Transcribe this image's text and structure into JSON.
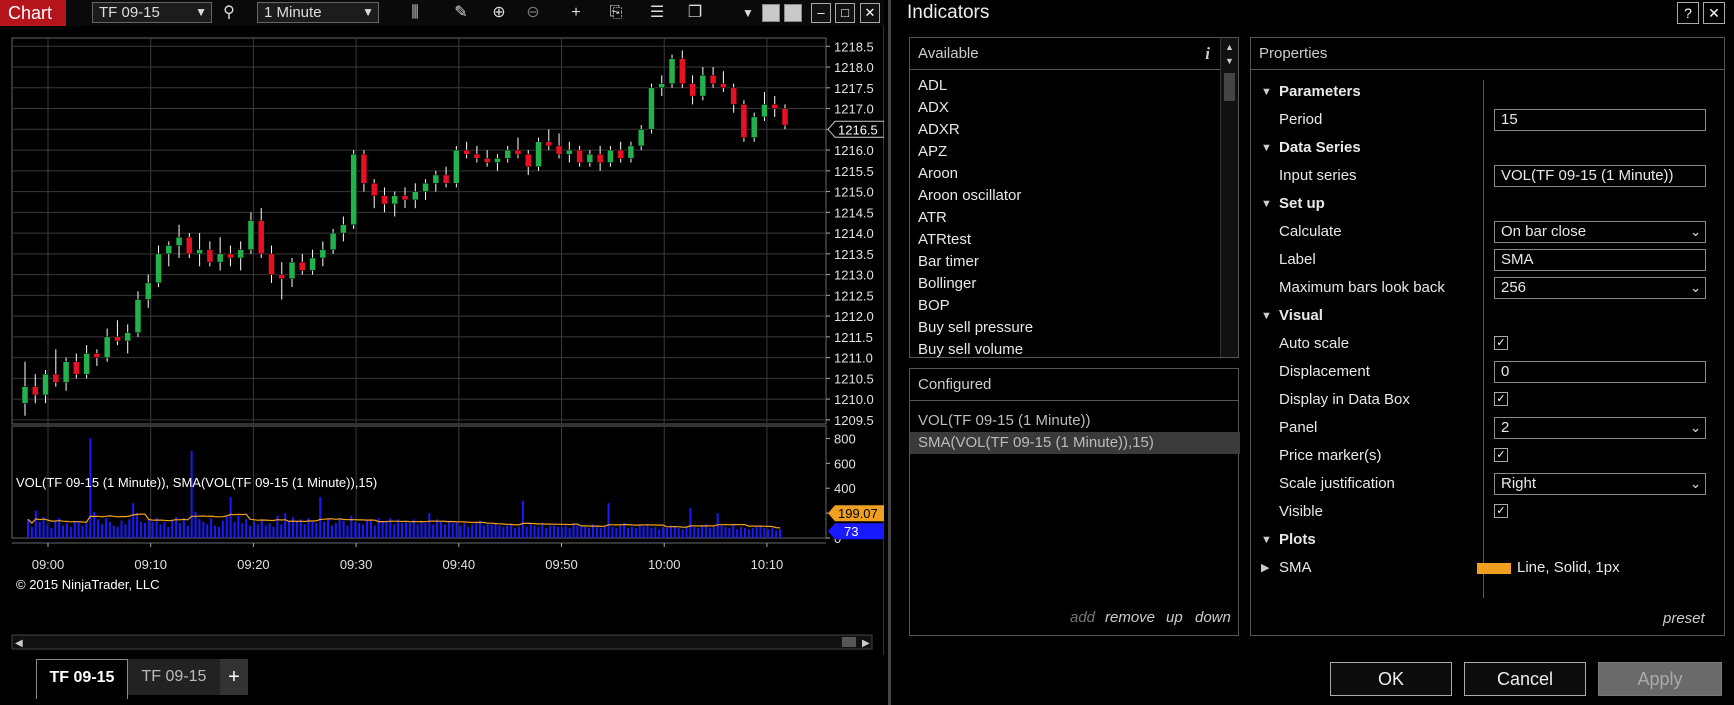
{
  "chart_window": {
    "title": "Chart",
    "instrument": "TF 09-15",
    "interval": "1 Minute",
    "tabs": [
      "TF 09-15",
      "TF 09-15"
    ],
    "add_tab_label": "+",
    "copyright": "© 2015 NinjaTrader, LLC",
    "indicator_label": "VOL(TF 09-15 (1 Minute)), SMA(VOL(TF 09-15 (1 Minute)),15)",
    "win_buttons": {
      "minimize": "–",
      "maximize": "□",
      "close": "✕"
    }
  },
  "chart_data": [
    {
      "type": "candlestick",
      "price_ticks": [
        "1218.5",
        "1218.0",
        "1217.5",
        "1217.0",
        "1216.5",
        "1216.0",
        "1215.5",
        "1215.0",
        "1214.5",
        "1214.0",
        "1213.5",
        "1213.0",
        "1212.5",
        "1212.0",
        "1211.5",
        "1211.0",
        "1210.5",
        "1210.0",
        "1209.5"
      ],
      "ylim": [
        1209.4,
        1218.7
      ],
      "last_price_label": "1216.5",
      "time_ticks": [
        "09:00",
        "09:10",
        "09:20",
        "09:30",
        "09:40",
        "09:50",
        "10:00",
        "10:10"
      ],
      "candles": [
        [
          1209.9,
          1210.9,
          1209.6,
          1210.3
        ],
        [
          1210.3,
          1210.6,
          1209.9,
          1210.1
        ],
        [
          1210.1,
          1210.7,
          1209.9,
          1210.6
        ],
        [
          1210.6,
          1211.2,
          1210.3,
          1210.4
        ],
        [
          1210.4,
          1211.0,
          1210.2,
          1210.9
        ],
        [
          1210.9,
          1211.1,
          1210.5,
          1210.6
        ],
        [
          1210.6,
          1211.3,
          1210.5,
          1211.1
        ],
        [
          1211.1,
          1211.2,
          1210.8,
          1211.0
        ],
        [
          1211.0,
          1211.7,
          1210.9,
          1211.5
        ],
        [
          1211.5,
          1211.9,
          1211.3,
          1211.4
        ],
        [
          1211.4,
          1211.8,
          1211.1,
          1211.6
        ],
        [
          1211.6,
          1212.6,
          1211.5,
          1212.4
        ],
        [
          1212.4,
          1213.0,
          1212.2,
          1212.8
        ],
        [
          1212.8,
          1213.7,
          1212.7,
          1213.5
        ],
        [
          1213.5,
          1213.8,
          1213.2,
          1213.7
        ],
        [
          1213.7,
          1214.2,
          1213.4,
          1213.9
        ],
        [
          1213.9,
          1214.0,
          1213.4,
          1213.5
        ],
        [
          1213.5,
          1214.0,
          1213.2,
          1213.6
        ],
        [
          1213.6,
          1213.8,
          1213.2,
          1213.3
        ],
        [
          1213.3,
          1213.9,
          1213.1,
          1213.5
        ],
        [
          1213.5,
          1213.7,
          1213.2,
          1213.4
        ],
        [
          1213.4,
          1213.8,
          1213.1,
          1213.6
        ],
        [
          1213.6,
          1214.5,
          1213.5,
          1214.3
        ],
        [
          1214.3,
          1214.6,
          1213.4,
          1213.5
        ],
        [
          1213.5,
          1213.7,
          1212.8,
          1213.0
        ],
        [
          1213.0,
          1213.3,
          1212.4,
          1212.9
        ],
        [
          1212.9,
          1213.4,
          1212.7,
          1213.3
        ],
        [
          1213.3,
          1213.5,
          1213.0,
          1213.1
        ],
        [
          1213.1,
          1213.6,
          1213.0,
          1213.4
        ],
        [
          1213.4,
          1213.8,
          1213.2,
          1213.6
        ],
        [
          1213.6,
          1214.1,
          1213.5,
          1214.0
        ],
        [
          1214.0,
          1214.4,
          1213.8,
          1214.2
        ],
        [
          1214.2,
          1216.0,
          1214.1,
          1215.9
        ],
        [
          1215.9,
          1216.0,
          1215.0,
          1215.2
        ],
        [
          1215.2,
          1215.3,
          1214.6,
          1214.9
        ],
        [
          1214.9,
          1215.1,
          1214.5,
          1214.7
        ],
        [
          1214.7,
          1215.0,
          1214.4,
          1214.9
        ],
        [
          1214.9,
          1215.1,
          1214.6,
          1214.8
        ],
        [
          1214.8,
          1215.2,
          1214.6,
          1215.0
        ],
        [
          1215.0,
          1215.3,
          1214.8,
          1215.2
        ],
        [
          1215.2,
          1215.5,
          1215.0,
          1215.4
        ],
        [
          1215.4,
          1215.6,
          1215.1,
          1215.2
        ],
        [
          1215.2,
          1216.1,
          1215.1,
          1216.0
        ],
        [
          1216.0,
          1216.2,
          1215.8,
          1215.9
        ],
        [
          1215.9,
          1216.1,
          1215.7,
          1215.8
        ],
        [
          1215.8,
          1216.0,
          1215.6,
          1215.7
        ],
        [
          1215.7,
          1215.9,
          1215.5,
          1215.8
        ],
        [
          1215.8,
          1216.1,
          1215.7,
          1216.0
        ],
        [
          1216.0,
          1216.3,
          1215.8,
          1215.9
        ],
        [
          1215.9,
          1216.0,
          1215.4,
          1215.6
        ],
        [
          1215.6,
          1216.3,
          1215.5,
          1216.2
        ],
        [
          1216.2,
          1216.5,
          1216.0,
          1216.1
        ],
        [
          1216.1,
          1216.4,
          1215.8,
          1215.9
        ],
        [
          1215.9,
          1216.2,
          1215.7,
          1216.0
        ],
        [
          1216.0,
          1216.1,
          1215.6,
          1215.7
        ],
        [
          1215.7,
          1216.0,
          1215.6,
          1215.9
        ],
        [
          1215.9,
          1216.1,
          1215.5,
          1215.7
        ],
        [
          1215.7,
          1216.1,
          1215.6,
          1216.0
        ],
        [
          1216.0,
          1216.2,
          1215.7,
          1215.8
        ],
        [
          1215.8,
          1216.2,
          1215.7,
          1216.1
        ],
        [
          1216.1,
          1216.6,
          1216.0,
          1216.5
        ],
        [
          1216.5,
          1217.6,
          1216.4,
          1217.5
        ],
        [
          1217.5,
          1217.8,
          1217.3,
          1217.6
        ],
        [
          1217.6,
          1218.3,
          1217.5,
          1218.2
        ],
        [
          1218.2,
          1218.4,
          1217.5,
          1217.6
        ],
        [
          1217.6,
          1217.8,
          1217.1,
          1217.3
        ],
        [
          1217.3,
          1218.0,
          1217.2,
          1217.8
        ],
        [
          1217.8,
          1218.0,
          1217.5,
          1217.6
        ],
        [
          1217.6,
          1217.9,
          1217.4,
          1217.5
        ],
        [
          1217.5,
          1217.6,
          1216.9,
          1217.1
        ],
        [
          1217.1,
          1217.2,
          1216.2,
          1216.3
        ],
        [
          1216.3,
          1216.9,
          1216.2,
          1216.8
        ],
        [
          1216.8,
          1217.4,
          1216.7,
          1217.1
        ],
        [
          1217.1,
          1217.3,
          1216.8,
          1217.0
        ],
        [
          1217.0,
          1217.1,
          1216.5,
          1216.6
        ]
      ],
      "colors": {
        "up": "#22b14c",
        "down": "#e81123"
      }
    },
    {
      "type": "bar",
      "series": [
        {
          "name": "VOL(TF 09-15 (1 Minute))",
          "color": "#1a1aff",
          "values": [
            150,
            90,
            220,
            130,
            170,
            110,
            80,
            140,
            160,
            100,
            120,
            90,
            140,
            130,
            100,
            120,
            800,
            210,
            150,
            110,
            160,
            130,
            100,
            90,
            140,
            110,
            150,
            280,
            200,
            130,
            120,
            150,
            130,
            160,
            110,
            130,
            90,
            140,
            170,
            120,
            160,
            100,
            700,
            210,
            150,
            130,
            110,
            160,
            100,
            90,
            140,
            170,
            330,
            130,
            180,
            120,
            150,
            100,
            130,
            110,
            150,
            100,
            120,
            90,
            180,
            110,
            200,
            130,
            170,
            140,
            150,
            110,
            160,
            130,
            120,
            330,
            130,
            150,
            100,
            120,
            160,
            140,
            100,
            180,
            130,
            120,
            110,
            140,
            140,
            100,
            160,
            130,
            140,
            160,
            110,
            150,
            120,
            130,
            120,
            150,
            110,
            130,
            120,
            200,
            110,
            150,
            130,
            110,
            140,
            120,
            130,
            100,
            120,
            90,
            110,
            120,
            140,
            100,
            110,
            110,
            110,
            100,
            90,
            100,
            110,
            80,
            90,
            300,
            90,
            110,
            100,
            90,
            120,
            80,
            100,
            100,
            90,
            90,
            100,
            80,
            120,
            100,
            90,
            90,
            80,
            110,
            90,
            80,
            100,
            280,
            90,
            80,
            100,
            120,
            80,
            90,
            80,
            100,
            90,
            110,
            80,
            90,
            70,
            90,
            80,
            100,
            90,
            80,
            70,
            90,
            240,
            90,
            80,
            100,
            110,
            80,
            90,
            200,
            100,
            90,
            80,
            110,
            70,
            90,
            80,
            70,
            80,
            90,
            100,
            80,
            70,
            80,
            60,
            70
          ]
        },
        {
          "name": "SMA(VOL(TF 09-15 (1 Minute)),15)",
          "color": "#f0a020"
        }
      ],
      "y_ticks": [
        "800",
        "600",
        "400",
        "200",
        "0"
      ],
      "ylim": [
        0,
        900
      ],
      "sma_label": "199.07",
      "vol_label": "73"
    }
  ],
  "dialog": {
    "title": "Indicators",
    "help_label": "?",
    "close_label": "✕",
    "available": {
      "header": "Available",
      "info_label": "i",
      "items": [
        "ADL",
        "ADX",
        "ADXR",
        "APZ",
        "Aroon",
        "Aroon oscillator",
        "ATR",
        "ATRtest",
        "Bar timer",
        "Bollinger",
        "BOP",
        "Buy sell pressure",
        "Buy sell volume"
      ]
    },
    "configured": {
      "header": "Configured",
      "items": [
        "VOL(TF 09-15 (1 Minute))",
        "SMA(VOL(TF 09-15 (1 Minute)),15)"
      ],
      "selected_index": 1,
      "actions": {
        "add": "add",
        "remove": "remove",
        "up": "up",
        "down": "down"
      }
    },
    "properties": {
      "header": "Properties",
      "sections": {
        "parameters": "Parameters",
        "data_series": "Data Series",
        "setup": "Set up",
        "visual": "Visual",
        "plots": "Plots"
      },
      "period": {
        "label": "Period",
        "value": "15"
      },
      "input_series": {
        "label": "Input series",
        "value": "VOL(TF 09-15 (1 Minute))"
      },
      "calculate": {
        "label": "Calculate",
        "value": "On bar close"
      },
      "label_field": {
        "label": "Label",
        "value": "SMA"
      },
      "max_bars": {
        "label": "Maximum bars look back",
        "value": "256"
      },
      "auto_scale": {
        "label": "Auto scale",
        "checked": "✓"
      },
      "displacement": {
        "label": "Displacement",
        "value": "0"
      },
      "display_in_data_box": {
        "label": "Display in Data Box",
        "checked": "✓"
      },
      "panel": {
        "label": "Panel",
        "value": "2"
      },
      "price_markers": {
        "label": "Price marker(s)",
        "checked": "✓"
      },
      "scale_justification": {
        "label": "Scale justification",
        "value": "Right"
      },
      "visible": {
        "label": "Visible",
        "checked": "✓"
      },
      "plot_sma": {
        "label": "SMA",
        "value": "Line, Solid, 1px",
        "color": "#f0a020"
      },
      "preset": "preset"
    },
    "buttons": {
      "ok": "OK",
      "cancel": "Cancel",
      "apply": "Apply"
    }
  }
}
